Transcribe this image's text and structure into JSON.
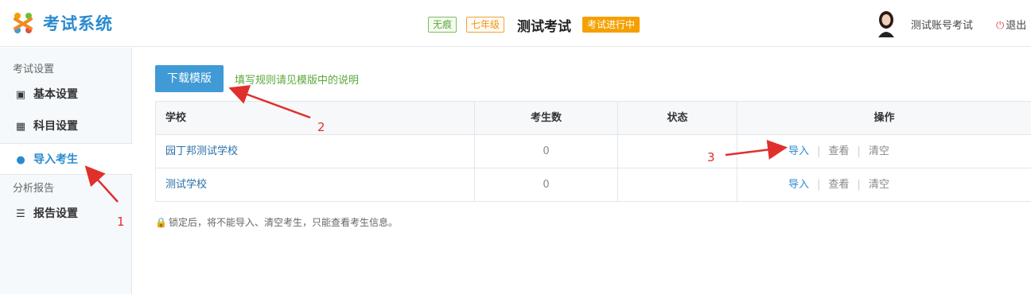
{
  "header": {
    "logo_text": "考试系统",
    "badge_green": "无痕",
    "badge_grade": "七年级",
    "exam_title": "测试考试",
    "exam_status": "考试进行中",
    "user_name": "测试账号考试",
    "logout_label": "退出"
  },
  "sidebar": {
    "group1": "考试设置",
    "items": [
      {
        "label": "基本设置",
        "icon": "user-card-icon"
      },
      {
        "label": "科目设置",
        "icon": "calendar-icon"
      },
      {
        "label": "导入考生",
        "icon": "users-icon",
        "active": true
      }
    ],
    "group2": "分析报告",
    "report_item": {
      "label": "报告设置",
      "icon": "list-icon"
    }
  },
  "toolbar": {
    "download_label": "下载模版",
    "hint": "填写规则请见模版中的说明"
  },
  "table": {
    "columns": [
      "学校",
      "考生数",
      "状态",
      "操作"
    ],
    "rows": [
      {
        "school": "园丁邦测试学校",
        "count": "0",
        "status": "",
        "actions": [
          "导入",
          "查看",
          "清空"
        ]
      },
      {
        "school": "测试学校",
        "count": "0",
        "status": "",
        "actions": [
          "导入",
          "查看",
          "清空"
        ]
      }
    ]
  },
  "lock_note": "锁定后，将不能导入、清空考生，只能查看考生信息。",
  "annotations": [
    "1",
    "2",
    "3"
  ],
  "colors": {
    "primary": "#2a8ad0",
    "status": "#f5a000",
    "annotation": "#e0302c"
  }
}
